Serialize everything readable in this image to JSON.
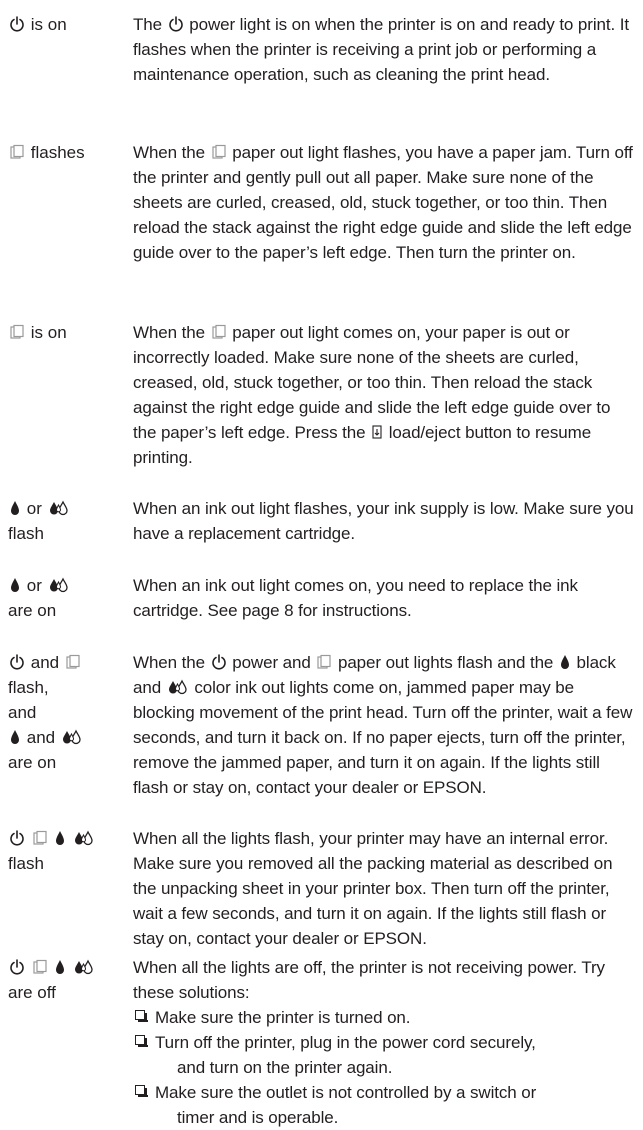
{
  "rows": [
    {
      "label": "is on",
      "text_a": "The",
      "text_b": "power light is on when the printer is on and ready to print. It flashes when the printer is receiving a print job or performing a maintenance operation, such as cleaning the print head."
    },
    {
      "label": "flashes",
      "text_a": "When the",
      "text_b": "paper out light flashes, you have a paper jam. Turn off the printer and gently pull out all paper. Make sure none of the sheets are curled, creased, old, stuck together, or too thin. Then reload the stack against the right edge guide and slide the left edge guide over to the paper’s left edge. Then turn the printer on."
    },
    {
      "label": "is on",
      "text_a": "When the",
      "text_b": "paper out light comes on, your paper is out or incorrectly loaded. Make sure none of the sheets are curled, creased, old, stuck together, or too thin. Then reload the stack against the right edge guide and slide the left edge guide over to the paper’s left edge. Press the",
      "text_c": "load/eject button to resume printing."
    },
    {
      "label_or": "or",
      "label_line2": "flash",
      "text": "When an ink out light flashes, your ink supply is low. Make sure you have a replacement cartridge."
    },
    {
      "label_or": "or",
      "label_line2": "are on",
      "text": "When an ink out light comes on, you need to replace the ink cartridge. See page 8 for instructions."
    },
    {
      "label_and1": "and",
      "label_line2": "flash,",
      "label_line3": "and",
      "label_and2": "and",
      "label_line5": "are on",
      "text_a": "When the",
      "text_b": "power and",
      "text_c": "paper out lights flash and the",
      "text_d": "black and",
      "text_e": "color ink out lights come on, jammed paper may be blocking movement of the print head. Turn off the printer, wait a few seconds, and turn it back on. If no paper ejects, turn off the printer, remove the jammed paper, and turn it on again. If the lights still flash or stay on, contact your dealer or EPSON."
    },
    {
      "label_line2": "flash",
      "text": "When all the lights flash, your printer may have an internal error. Make sure you removed all the packing material as described on the unpacking sheet in your printer box. Then turn off the printer, wait a few seconds, and turn it on again. If the lights still flash or stay on, contact your dealer or EPSON."
    },
    {
      "label_line2": "are off",
      "text": "When all the lights are off, the printer is not receiving power. Try these solutions:",
      "bullets": [
        "Make sure the printer is turned on.",
        "Turn off the printer, plug in the power cord securely,",
        "Make sure the outlet is not controlled by a switch or"
      ],
      "bullet_cont": [
        "",
        "and turn on the printer again.",
        "timer and is operable."
      ]
    }
  ],
  "icons": {
    "power": "power-icon",
    "paper": "paper-out-icon",
    "black_ink": "black-ink-icon",
    "color_ink": "color-ink-icon",
    "load_eject": "load-eject-icon",
    "checkbox": "checkbox-icon"
  }
}
